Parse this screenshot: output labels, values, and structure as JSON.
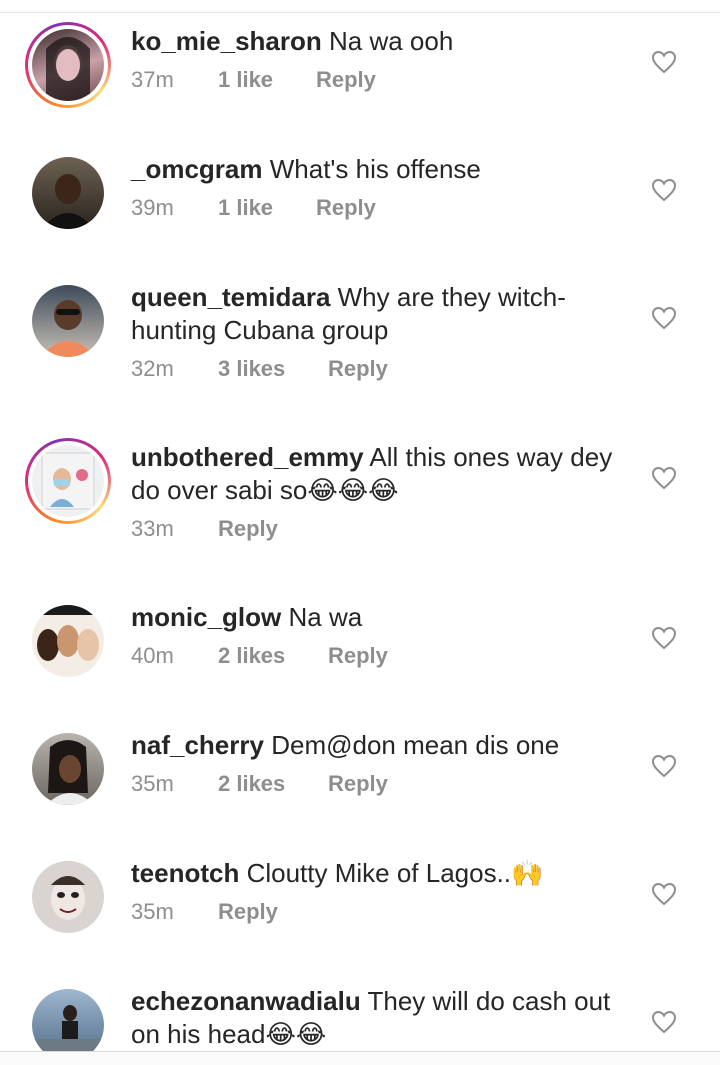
{
  "comments": [
    {
      "username": "ko_mie_sharon",
      "text": "Na wa ooh",
      "time": "37m",
      "likes": "1 like",
      "reply": "Reply"
    },
    {
      "username": "_omcgram",
      "text": "What's his offense",
      "time": "39m",
      "likes": "1 like",
      "reply": "Reply"
    },
    {
      "username": "queen_temidara",
      "text": "Why are they witch-hunting Cubana group",
      "time": "32m",
      "likes": "3 likes",
      "reply": "Reply"
    },
    {
      "username": "unbothered_emmy",
      "text": "All this ones way dey do over sabi so😂😂😂",
      "time": "33m",
      "likes": "",
      "reply": "Reply"
    },
    {
      "username": "monic_glow",
      "text": "Na wa",
      "time": "40m",
      "likes": "2 likes",
      "reply": "Reply"
    },
    {
      "username": "naf_cherry",
      "text": "Dem@don mean dis one",
      "time": "35m",
      "likes": "2 likes",
      "reply": "Reply"
    },
    {
      "username": "teenotch",
      "text": "Cloutty Mike of Lagos..🙌",
      "time": "35m",
      "likes": "",
      "reply": "Reply"
    },
    {
      "username": "echezonanwadialu",
      "text": "They will do cash out on his head😂😂",
      "time": "",
      "likes": "",
      "reply": ""
    }
  ],
  "icons": {
    "like": "heart-outline-icon"
  },
  "colors": {
    "text": "#262626",
    "meta": "#8e8e8e",
    "heart": "#8e8e8e"
  }
}
